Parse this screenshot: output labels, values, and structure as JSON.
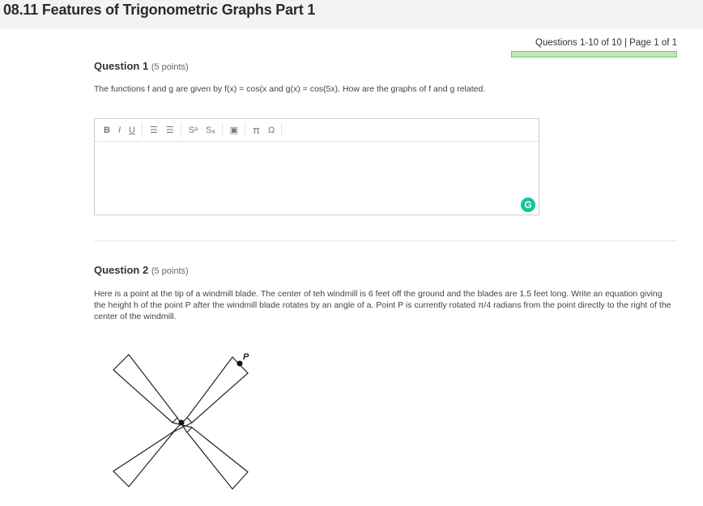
{
  "page": {
    "title": "08.11 Features of Trigonometric Graphs Part 1"
  },
  "progress": {
    "label": "Questions 1-10 of 10 | Page 1 of 1",
    "fraction": 1.0
  },
  "questions": [
    {
      "title": "Question 1",
      "points": "(5 points)",
      "text": "The functions f and g are given by f(x) = cos(x and g(x) = cos(5x). How are the graphs of f and g related."
    },
    {
      "title": "Question 2",
      "points": "(5 points)",
      "text": "Here is a point at the tip of a windmill blade. The center of teh windmill is 6 feet off the ground and the blades are 1.5 feet long. Write an equation giving the height h of the point P after the windmill blade rotates by an angle of a. Point P is currently rotated π/4 radians from the point directly to the right of the center of the windmill.",
      "figure_label": "P"
    }
  ],
  "editor": {
    "toolbar": {
      "bold": "B",
      "italic": "I",
      "underline": "U",
      "bullet_list": "☰",
      "numbered_list": "☰",
      "superscript": "Sᵃ",
      "subscript": "Sₐ",
      "image": "▣",
      "pi": "π",
      "omega": "Ω"
    },
    "value": "",
    "grammarly": "G"
  },
  "colors": {
    "progress_border": "#7cc576",
    "grammarly": "#15c39a"
  },
  "icons": [
    "bold-icon",
    "italic-icon",
    "underline-icon",
    "bullet-list-icon",
    "numbered-list-icon",
    "superscript-icon",
    "subscript-icon",
    "image-icon",
    "pi-icon",
    "omega-icon",
    "grammarly-icon"
  ]
}
